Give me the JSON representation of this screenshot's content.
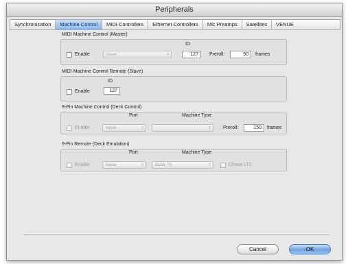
{
  "window": {
    "title": "Peripherals"
  },
  "tabs": [
    "Synchronization",
    "Machine Control",
    "MIDI Controllers",
    "Ethernet Controllers",
    "Mic Preamps",
    "Satellites",
    "VENUE"
  ],
  "active_tab": "Machine Control",
  "mmc_master": {
    "title": "MIDI Machine Control (Master)",
    "enable_label": "Enable",
    "enabled": false,
    "device_value": "none",
    "id_label": "ID",
    "id_value": "127",
    "preroll_label": "Preroll:",
    "preroll_value": "90",
    "frames_label": "frames"
  },
  "mmc_remote": {
    "title": "MIDI Machine Control Remote (Slave)",
    "enable_label": "Enable",
    "enabled": false,
    "id_label": "ID",
    "id_value": "127"
  },
  "ninepin_control": {
    "title": "9-Pin Machine Control (Deck Control)",
    "enable_label": "Enable",
    "port_label": "Port",
    "port_value": "None",
    "machine_type_label": "Machine Type",
    "machine_type_value": "",
    "preroll_label": "Preroll:",
    "preroll_value": "150",
    "frames_label": "frames"
  },
  "ninepin_remote": {
    "title": "9-Pin Remote (Deck Emulation)",
    "enable_label": "Enable",
    "port_label": "Port",
    "port_value": "None",
    "machine_type_label": "Machine Type",
    "machine_type_value": "BVW-75",
    "chase_ltc_label": "Chase LTC"
  },
  "buttons": {
    "cancel": "Cancel",
    "ok": "OK"
  }
}
